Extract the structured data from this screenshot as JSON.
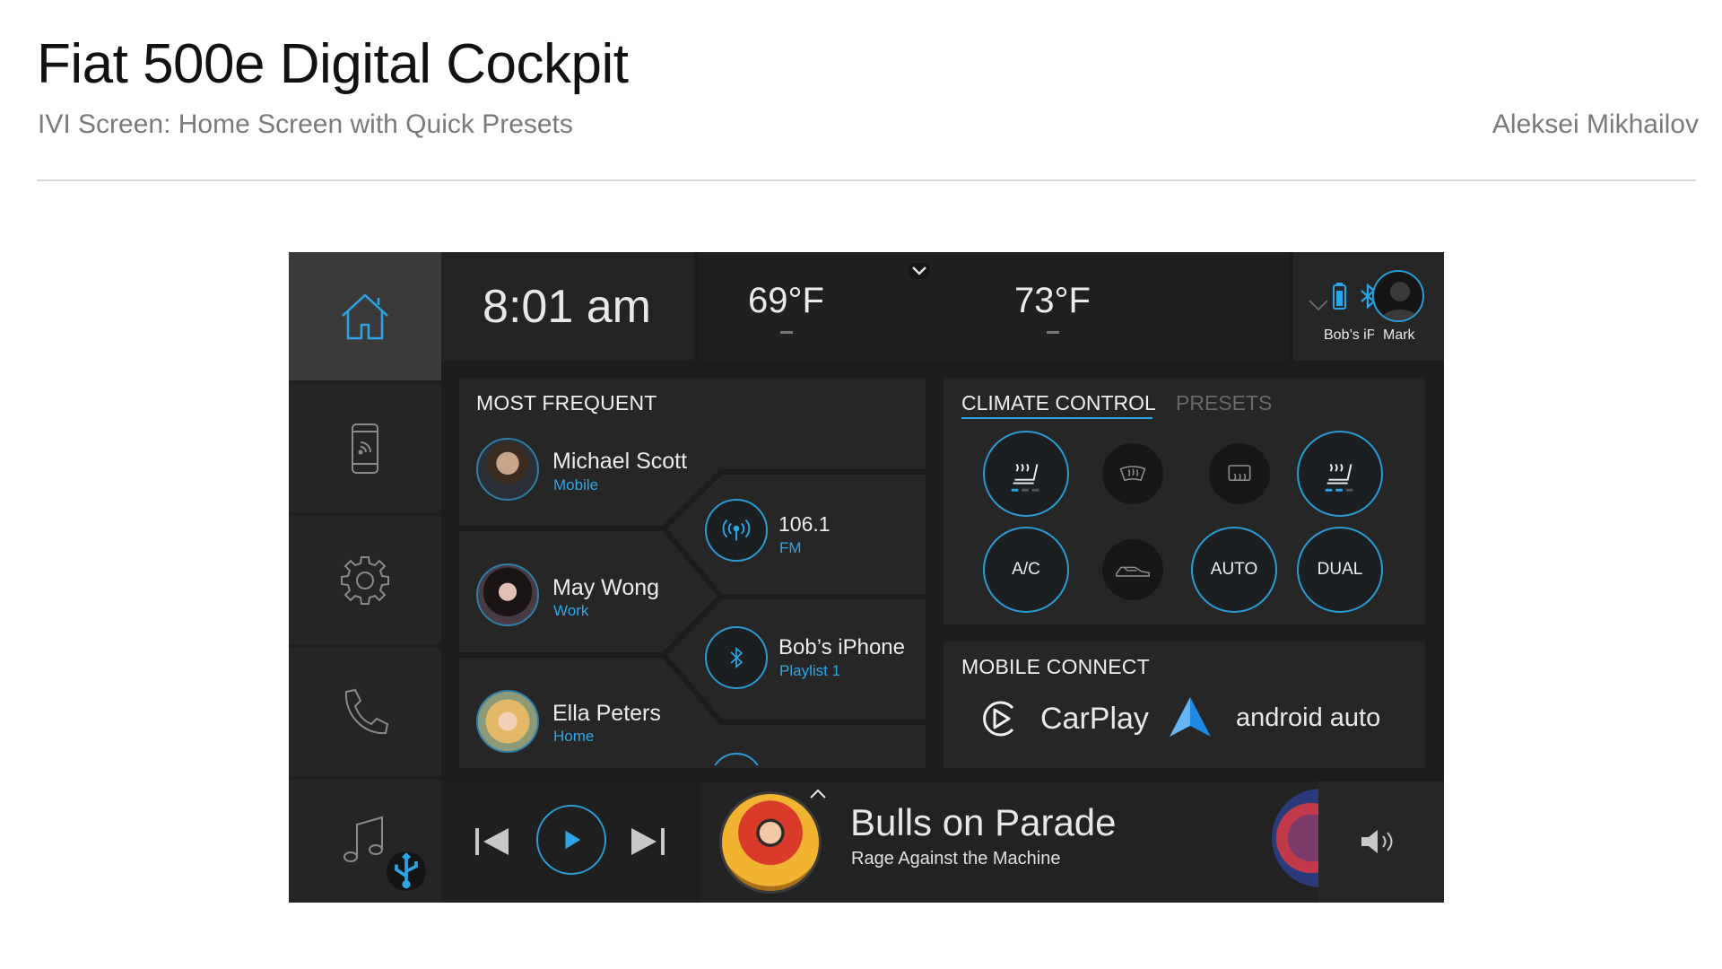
{
  "header": {
    "title": "Fiat 500e Digital Cockpit",
    "subtitle": "IVI Screen: Home Screen with Quick Presets",
    "author": "Aleksei Mikhailov"
  },
  "topbar": {
    "time": "8:01 am",
    "temp_left": "69°F",
    "temp_right": "73°F",
    "device_label": "Bob’s iPhone",
    "user_label": "Mark"
  },
  "most_frequent": {
    "title": "MOST FREQUENT",
    "contacts": [
      {
        "name": "Michael Scott",
        "sub": "Mobile"
      },
      {
        "name": "May Wong",
        "sub": "Work"
      },
      {
        "name": "Ella Peters",
        "sub": "Home"
      }
    ],
    "sources": [
      {
        "name": "106.1",
        "sub": "FM",
        "icon": "radio-icon"
      },
      {
        "name": "Bob’s iPhone",
        "sub": "Playlist 1",
        "icon": "bluetooth-icon"
      }
    ]
  },
  "climate": {
    "tabs": [
      "CLIMATE CONTROL",
      "PRESETS"
    ],
    "active_tab": "CLIMATE CONTROL",
    "buttons_row2": [
      "A/C",
      "AUTO",
      "DUAL"
    ]
  },
  "mobile_connect": {
    "title": "MOBILE CONNECT",
    "carplay": "CarPlay",
    "android": "android auto"
  },
  "now_playing": {
    "title": "Bulls on Parade",
    "artist": "Rage Against the Machine"
  },
  "colors": {
    "accent": "#2aa6e8",
    "background": "#1d1d1d"
  }
}
